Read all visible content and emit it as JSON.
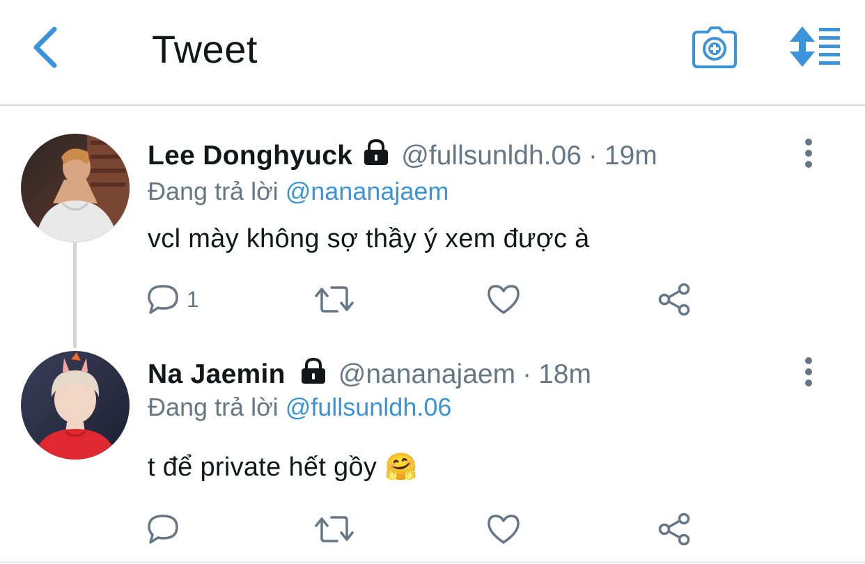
{
  "header": {
    "title": "Tweet",
    "back_icon": "chevron-left-icon",
    "camera_icon": "camera-plus-icon",
    "sort_icon": "sort-list-icon",
    "accent_color": "#3b94d9"
  },
  "tweets": [
    {
      "display_name": "Lee Donghyuck",
      "protected": true,
      "handle": "@fullsunldh.06",
      "separator": "·",
      "time": "19m",
      "reply_prefix": "Đang trả lời",
      "reply_to": "@nananajaem",
      "text": "vcl mày không sợ thầy ý xem được à",
      "reply_count": "1"
    },
    {
      "display_name": "Na Jaemin",
      "protected": true,
      "handle": "@nananajaem",
      "separator": "·",
      "time": "18m",
      "reply_prefix": "Đang trả lời",
      "reply_to": "@fullsunldh.06",
      "text": "t để private hết gồy",
      "emoji": "🤗",
      "reply_count": ""
    }
  ],
  "colors": {
    "text_primary": "#14171a",
    "text_secondary": "#657786",
    "link": "#3b94d9",
    "divider": "#d4d7da"
  }
}
